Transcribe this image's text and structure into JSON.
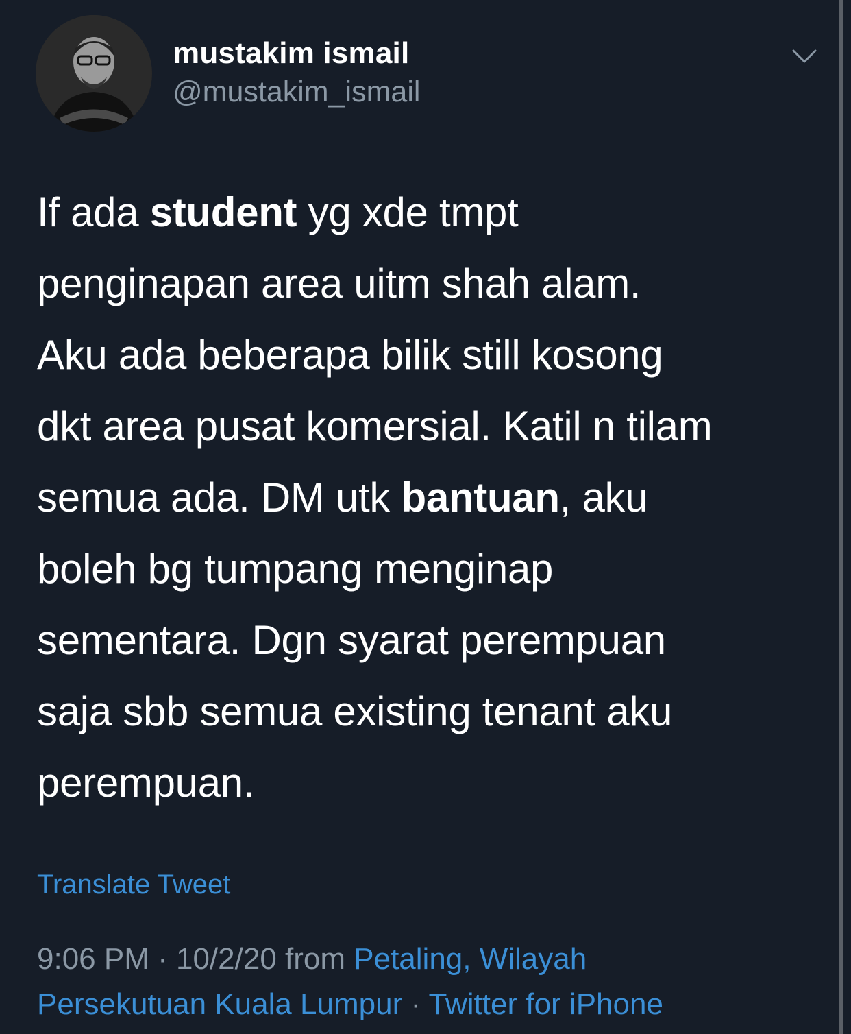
{
  "author": {
    "display_name": "mustakim ismail",
    "handle": "@mustakim_ismail"
  },
  "tweet": {
    "lines": [
      [
        {
          "t": "If ada "
        },
        {
          "t": "student",
          "b": true
        },
        {
          "t": " yg xde tmpt"
        }
      ],
      [
        {
          "t": "penginapan area uitm shah alam."
        }
      ],
      [
        {
          "t": "Aku ada beberapa bilik still kosong"
        }
      ],
      [
        {
          "t": "dkt area pusat komersial. Katil n tilam"
        }
      ],
      [
        {
          "t": "semua ada. DM utk "
        },
        {
          "t": "bantuan",
          "b": true
        },
        {
          "t": ", aku"
        }
      ],
      [
        {
          "t": "boleh bg tumpang menginap"
        }
      ],
      [
        {
          "t": "sementara. Dgn syarat perempuan"
        }
      ],
      [
        {
          "t": "saja sbb semua existing tenant aku"
        }
      ],
      [
        {
          "t": "perempuan."
        }
      ]
    ]
  },
  "translate_label": "Translate Tweet",
  "meta": {
    "time": "9:06 PM",
    "sep1": " · ",
    "date": "10/2/20",
    "from": " from ",
    "location_line1": "Petaling, Wilayah",
    "location_line2": "Persekutuan Kuala Lumpur",
    "sep2": " · ",
    "source": "Twitter for iPhone"
  },
  "icons": {
    "avatar": "profile-photo",
    "menu": "chevron-down-icon"
  },
  "colors": {
    "background": "#161d28",
    "text": "#ffffff",
    "secondary": "#8b98a5",
    "link": "#3b8fd6"
  }
}
